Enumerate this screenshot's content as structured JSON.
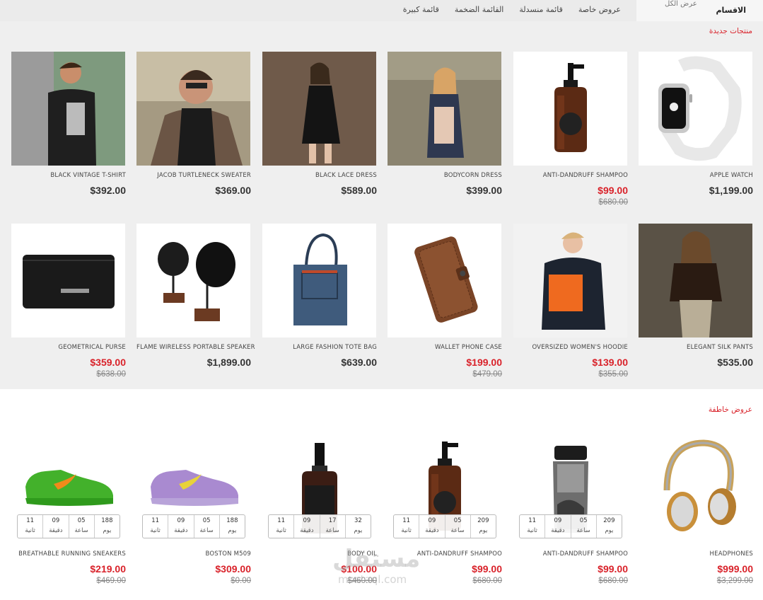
{
  "nav": {
    "categories_title": "الاقسام",
    "view_all": "عرض الكل",
    "links": [
      "عروض خاصة",
      "قائمة منسدلة",
      "القائمة الضخمة",
      "قائمة كبيرة"
    ]
  },
  "colors": {
    "accent": "#d9222a",
    "section_bg": "#efefef",
    "nav_bg": "#ebebeb"
  },
  "new_products": {
    "title": "منتجات جديدة",
    "items": [
      {
        "name": "APPLE WATCH",
        "price": "$1,199.00",
        "old_price": "",
        "icon": "apple-watch"
      },
      {
        "name": "ANTI-DANDRUFF SHAMPOO",
        "price": "$99.00",
        "old_price": "$680.00",
        "icon": "shampoo-bottle"
      },
      {
        "name": "BODYCORN DRESS",
        "price": "$399.00",
        "old_price": "",
        "icon": "model-dress"
      },
      {
        "name": "BLACK LACE DRESS",
        "price": "$589.00",
        "old_price": "",
        "icon": "model-black-dress"
      },
      {
        "name": "JACOB TURTLENECK SWEATER",
        "price": "$369.00",
        "old_price": "",
        "icon": "model-sweater"
      },
      {
        "name": "BLACK VINTAGE T-SHIRT",
        "price": "$392.00",
        "old_price": "",
        "icon": "model-tshirt"
      },
      {
        "name": "ELEGANT SILK PANTS",
        "price": "$535.00",
        "old_price": "",
        "icon": "model-jacket"
      },
      {
        "name": "OVERSIZED WOMEN'S HOODIE",
        "price": "$139.00",
        "old_price": "$355.00",
        "icon": "model-hoodie"
      },
      {
        "name": "WALLET PHONE CASE",
        "price": "$199.00",
        "old_price": "$479.00",
        "icon": "phone-case"
      },
      {
        "name": "LARGE FASHION TOTE BAG",
        "price": "$639.00",
        "old_price": "",
        "icon": "tote-bag"
      },
      {
        "name": "FLAME WIRELESS PORTABLE SPEAKER",
        "price": "$1,899.00",
        "old_price": "",
        "icon": "gramophone-speaker"
      },
      {
        "name": "GEOMETRICAL PURSE",
        "price": "$359.00",
        "old_price": "$638.00",
        "icon": "purse"
      }
    ]
  },
  "flash_deals": {
    "title": "عروض خاطفة",
    "countdown_labels": {
      "days": "يوم",
      "hours": "ساعة",
      "minutes": "دقيقة",
      "seconds": "ثانية"
    },
    "items": [
      {
        "name": "HEADPHONES",
        "price": "$999.00",
        "old_price": "$3,299.00",
        "icon": "headphones",
        "countdown": null
      },
      {
        "name": "ANTI-DANDRUFF SHAMPOO",
        "price": "$99.00",
        "old_price": "$680.00",
        "icon": "shampoo-grey",
        "countdown": {
          "days": "209",
          "hours": "05",
          "minutes": "09",
          "seconds": "11"
        }
      },
      {
        "name": "ANTI-DANDRUFF SHAMPOO",
        "price": "$99.00",
        "old_price": "$680.00",
        "icon": "shampoo-bottle",
        "countdown": {
          "days": "209",
          "hours": "05",
          "minutes": "09",
          "seconds": "11"
        }
      },
      {
        "name": "BODY OIL",
        "price": "$100.00",
        "old_price": "$460.00",
        "icon": "cosmetic-bottle",
        "countdown": {
          "days": "32",
          "hours": "17",
          "minutes": "09",
          "seconds": "11"
        }
      },
      {
        "name": "BOSTON M509",
        "price": "$309.00",
        "old_price": "$0.00",
        "icon": "purple-sneaker",
        "countdown": {
          "days": "188",
          "hours": "05",
          "minutes": "09",
          "seconds": "11"
        }
      },
      {
        "name": "BREATHABLE RUNNING SNEAKERS",
        "price": "$219.00",
        "old_price": "$469.00",
        "icon": "green-sneaker",
        "countdown": {
          "days": "188",
          "hours": "05",
          "minutes": "09",
          "seconds": "11"
        }
      }
    ]
  },
  "watermark": {
    "main": "مستقل",
    "sub": "mostaql.com"
  }
}
